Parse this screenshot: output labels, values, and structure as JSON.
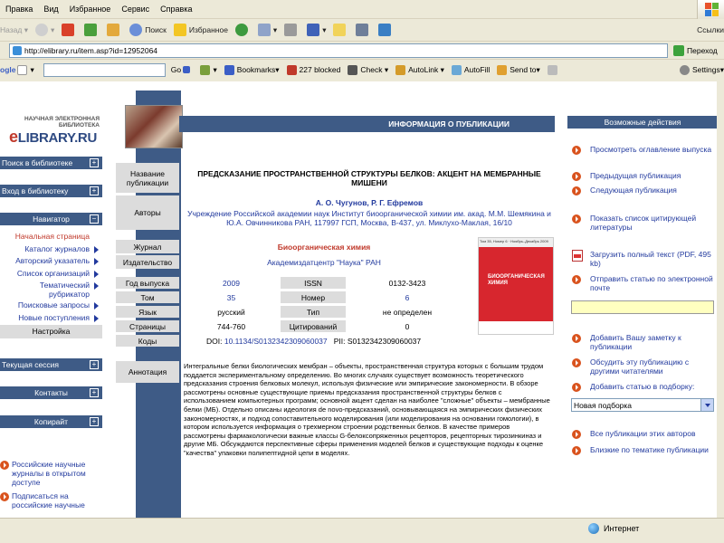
{
  "browser": {
    "menu": [
      "Правка",
      "Вид",
      "Избранное",
      "Сервис",
      "Справка"
    ],
    "toolbar": {
      "back": "Назад",
      "search": "Поиск",
      "favorites": "Избранное",
      "links": "Ссылки"
    },
    "address": {
      "value": "http://elibrary.ru/item.asp?id=12952064",
      "go": "Переход"
    },
    "google_bar": {
      "go": "Go",
      "bookmarks": "Bookmarks▾",
      "blocked": "227 blocked",
      "check": "Check",
      "autolink": "AutoLink",
      "autofill": "AutoFill",
      "sendto": "Send to▾",
      "settings": "Settings▾"
    },
    "status": {
      "zone": "Интернет"
    }
  },
  "logo": {
    "line1": "НАУЧНАЯ ЭЛЕКТРОННАЯ",
    "line2": "БИБЛИОТЕКА",
    "brand": "LIBRARY.RU"
  },
  "sidebar": {
    "search": "Поиск в библиотеке",
    "login": "Вход в библиотеку",
    "navigator": "Навигатор",
    "items": [
      {
        "label": "Начальная страница",
        "active": true
      },
      {
        "label": "Каталог журналов"
      },
      {
        "label": "Авторский указатель"
      },
      {
        "label": "Список организаций"
      },
      {
        "label": "Тематический рубрикатор"
      },
      {
        "label": "Поисковые запросы"
      },
      {
        "label": "Новые поступления"
      }
    ],
    "settings": "Настройка",
    "session": "Текущая сессия",
    "contacts": "Контакты",
    "copyright": "Копирайт",
    "news": [
      "Российские научные журналы в открытом доступе",
      "Подписаться на российские научные"
    ]
  },
  "publication": {
    "header": "ИНФОРМАЦИЯ О ПУБЛИКАЦИИ",
    "labels": {
      "title": "Название публикации",
      "authors": "Авторы",
      "journal": "Журнал",
      "publisher": "Издательство",
      "year": "Год выпуска",
      "issn": "ISSN",
      "volume": "Том",
      "number": "Номер",
      "language": "Язык",
      "type": "Тип",
      "pages": "Страницы",
      "citations": "Цитирований",
      "codes": "Коды",
      "abstract": "Аннотация"
    },
    "title": "ПРЕДСКАЗАНИЕ ПРОСТРАНСТВЕННОЙ СТРУКТУРЫ БЕЛКОВ: АКЦЕНТ НА МЕМБРАННЫЕ МИШЕНИ",
    "authors": "А. О. Чугунов, Р. Г. Ефремов",
    "affiliation": "Учреждение Российской академии наук Институт биоорганической химии им. акад. М.М. Шемякина и Ю.А. Овчинникова РАН, 117997 ГСП, Москва, В-437, ул. Миклухо-Маклая, 16/10",
    "journal": "Биоорганическая химия",
    "publisher": "Академиздатцентр \"Наука\" РАН",
    "year": "2009",
    "issn": "0132-3423",
    "volume": "35",
    "number": "6",
    "language": "русский",
    "type": "не определен",
    "pages": "744-760",
    "citations": "0",
    "doi_prefix": "DOI:",
    "doi": "10.1134/S0132342309060037",
    "pii": "PII: S0132342309060037",
    "abstract": "Интегральные белки биологических мембран – объекты, пространственная структура которых с большим трудом поддается экспериментальному определению. Во многих случаях существует возможность теоретического предсказания строения белковых молекул, используя физические или эмпирические закономерности. В обзоре рассмотрены основные существующие приемы предсказания пространственной структуры белков с использованием компьютерных программ; основной акцент сделан на наиболее \"сложные\" объекты – мембранные белки (МБ). Отдельно описаны идеология de novo-предсказаний, основывающаяся на эмпирических физических закономерностях, и подход сопоставительного моделирования (или моделирования на основании гомологии), в котором используется информация о трехмерном строении родственных белков. В качестве примеров рассмотрены фармакологически важные классы G-белоксопряженных рецепторов, рецепторных тирозинкиназ и другие МБ. Обсуждаются перспективные сферы применения моделей белков и существующие подходы к оценке \"качества\" упаковки полипептидной цепи в моделях.",
    "cover": {
      "header": "Том 35, Номер 6 · Ноябрь–Декабрь 2009",
      "title": "БИООРГАНИЧЕСКАЯ ХИМИЯ"
    }
  },
  "actions": {
    "header": "Возможные действия",
    "items": [
      "Просмотреть оглавление выпуска",
      "Предыдущая публикация",
      "Следующая публикация",
      "Показать список цитирующей литературы",
      "Загрузить полный текст (PDF, 495 kb)",
      "Отправить статью по электронной почте",
      "Добавить Вашу заметку к публикации",
      "Обсудить эту публикацию с другими читателями",
      "Добавить статью в подборку:",
      "Все публикации этих авторов",
      "Близкие по тематике публикации"
    ],
    "collection_select": "Новая подборка"
  }
}
